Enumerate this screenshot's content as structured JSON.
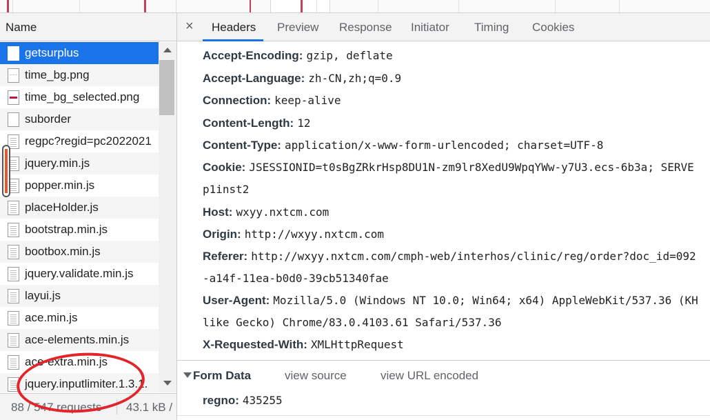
{
  "name_column": {
    "header": "Name"
  },
  "files": [
    {
      "name": "getsurplus",
      "icon": "document-icon",
      "selected": true
    },
    {
      "name": "time_bg.png",
      "icon": "image-icon"
    },
    {
      "name": "time_bg_selected.png",
      "icon": "image-red-icon"
    },
    {
      "name": "suborder",
      "icon": "document-icon"
    },
    {
      "name": "regpc?regid=pc2022021",
      "icon": "script-icon"
    },
    {
      "name": "jquery.min.js",
      "icon": "script-icon"
    },
    {
      "name": "popper.min.js",
      "icon": "script-icon"
    },
    {
      "name": "placeHolder.js",
      "icon": "script-icon"
    },
    {
      "name": "bootstrap.min.js",
      "icon": "script-icon"
    },
    {
      "name": "bootbox.min.js",
      "icon": "script-icon"
    },
    {
      "name": "jquery.validate.min.js",
      "icon": "script-icon"
    },
    {
      "name": "layui.js",
      "icon": "script-icon"
    },
    {
      "name": "ace.min.js",
      "icon": "script-icon"
    },
    {
      "name": "ace-elements.min.js",
      "icon": "script-icon"
    },
    {
      "name": "ace-extra.min.js",
      "icon": "script-icon"
    },
    {
      "name": "jquery.inputlimiter.1.3.1.",
      "icon": "script-icon"
    }
  ],
  "status": {
    "requests": "88 / 547 requests",
    "size": "43.1 kB /"
  },
  "tabs": {
    "close": "×",
    "headers": "Headers",
    "preview": "Preview",
    "response": "Response",
    "initiator": "Initiator",
    "timing": "Timing",
    "cookies": "Cookies"
  },
  "headers": {
    "accept_encoding": {
      "key": "Accept-Encoding:",
      "value": "gzip, deflate"
    },
    "accept_language": {
      "key": "Accept-Language:",
      "value": "zh-CN,zh;q=0.9"
    },
    "connection": {
      "key": "Connection:",
      "value": "keep-alive"
    },
    "content_length": {
      "key": "Content-Length:",
      "value": "12"
    },
    "content_type": {
      "key": "Content-Type:",
      "value": "application/x-www-form-urlencoded; charset=UTF-8"
    },
    "cookie": {
      "key": "Cookie:",
      "value": "JSESSIONID=t0sBgZRkrHsp8DU1N-zm9lr8XedU9WpqYWw-y7U3.ecs-6b3a; SERVE",
      "cont": "p1inst2"
    },
    "host": {
      "key": "Host:",
      "value": "wxyy.nxtcm.com"
    },
    "origin": {
      "key": "Origin:",
      "value": "http://wxyy.nxtcm.com"
    },
    "referer": {
      "key": "Referer:",
      "value": "http://wxyy.nxtcm.com/cmph-web/interhos/clinic/reg/order?doc_id=092",
      "cont": "-a14f-11ea-b0d0-39cb51340fae"
    },
    "user_agent": {
      "key": "User-Agent:",
      "value": "Mozilla/5.0 (Windows NT 10.0; Win64; x64) AppleWebKit/537.36 (KH",
      "cont": "like Gecko) Chrome/83.0.4103.61 Safari/537.36"
    },
    "x_requested_with": {
      "key": "X-Requested-With:",
      "value": "XMLHttpRequest"
    }
  },
  "form_data": {
    "title": "Form Data",
    "view_source": "view source",
    "view_url_encoded": "view URL encoded",
    "regno_key": "regno:",
    "regno_value": "435255"
  },
  "colors": {
    "accent": "#1a73e8",
    "annotation": "#e3242b",
    "marker": "#e8572c"
  }
}
